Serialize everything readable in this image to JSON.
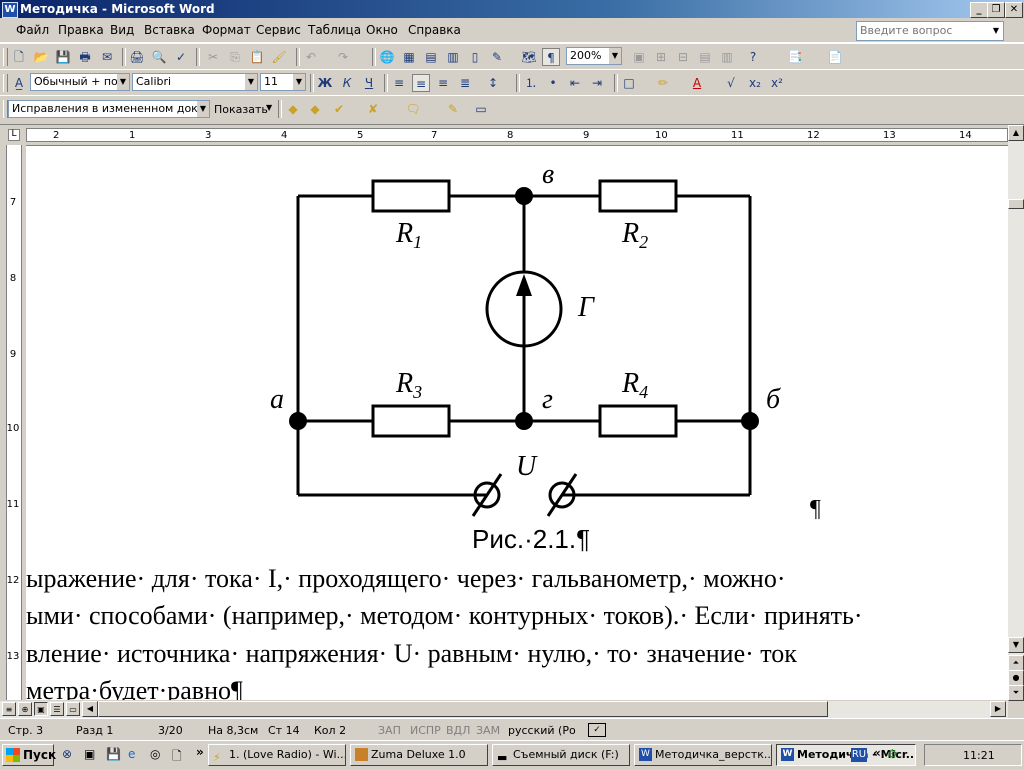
{
  "window": {
    "title": "Методичка - Microsoft Word",
    "app_icon": "W"
  },
  "menu": [
    "Файл",
    "Правка",
    "Вид",
    "Вставка",
    "Формат",
    "Сервис",
    "Таблица",
    "Окно",
    "Справка"
  ],
  "help_search": {
    "placeholder": "Введите вопрос"
  },
  "toolbar_standard": {
    "zoom": "200%"
  },
  "toolbar_formatting": {
    "style": "Обычный + по ц",
    "font": "Calibri",
    "size": "11"
  },
  "toolbar_reviewing": {
    "display_mode": "Исправления в измененном документе",
    "show_label": "Показать"
  },
  "ruler_h": [
    "2",
    "1",
    "1",
    "2",
    "3",
    "4",
    "5",
    "6",
    "7",
    "8",
    "9",
    "10",
    "11",
    "12",
    "13",
    "14"
  ],
  "ruler_v": [
    "7",
    "8",
    "9",
    "10",
    "11",
    "12",
    "13"
  ],
  "diagram": {
    "labels": {
      "r1": "R",
      "r1_sub": "1",
      "r2": "R",
      "r2_sub": "2",
      "r3": "R",
      "r3_sub": "3",
      "r4": "R",
      "r4_sub": "4",
      "g": "Г",
      "u": "U",
      "node_a": "а",
      "node_b": "б",
      "node_v": "в",
      "node_g": "г"
    }
  },
  "document": {
    "pilcrow": "¶",
    "caption": "Рис.·2.1.¶",
    "lines": [
      "ыражение· для· тока· I,· проходящего· через· гальванометр,· можно·",
      "ыми· способами· (например,· методом· контурных· токов).· Если· принять·",
      "вление· источника· напряжения· U· равным· нулю,· то· значение· ток",
      "метра·будет·равно¶"
    ]
  },
  "status": {
    "page": "Стр. 3",
    "section": "Разд 1",
    "pages": "3/20",
    "at": "На 8,3см",
    "line": "Ст 14",
    "col": "Кол 2",
    "rec": "ЗАП",
    "trk": "ИСПР",
    "ext": "ВДЛ",
    "ovr": "ЗАМ",
    "lang": "русский (Ро"
  },
  "taskbar": {
    "start": "Пуск",
    "tasks": [
      "1. (Love Radio) - Wi...",
      "Zuma Deluxe 1.0",
      "Съемный диск (F:)",
      "Методичка_верстк...",
      "Методичка - Micr..."
    ],
    "lang": "RU",
    "clock": "11:21"
  }
}
